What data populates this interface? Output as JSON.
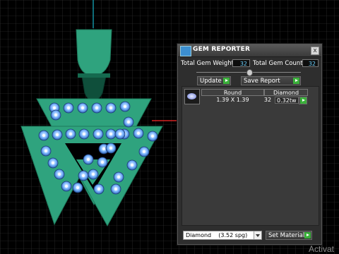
{
  "panel": {
    "title": "GEM REPORTER",
    "close_glyph": "x",
    "total_weight_label": "Total Gem Weight",
    "total_weight_value": "32",
    "total_count_label": "Total Gem Count",
    "total_count_value": "32",
    "update_label": "Update",
    "save_report_label": "Save Report",
    "table": {
      "headers": [
        "Round",
        "Diamond"
      ],
      "row": {
        "shape": "Round",
        "size": "1.39 X 1.39",
        "count": "32",
        "carat": "0.32tw"
      }
    },
    "material_select": "Diamond    (3.52 spg)",
    "set_material_label": "Set Material"
  },
  "watermark": "Activat",
  "colors": {
    "pendant_green": "#2fa37e",
    "gem_blue": "#5aa7ff",
    "axis_red": "#ff2b2b",
    "axis_cyan": "#16b3c8"
  }
}
